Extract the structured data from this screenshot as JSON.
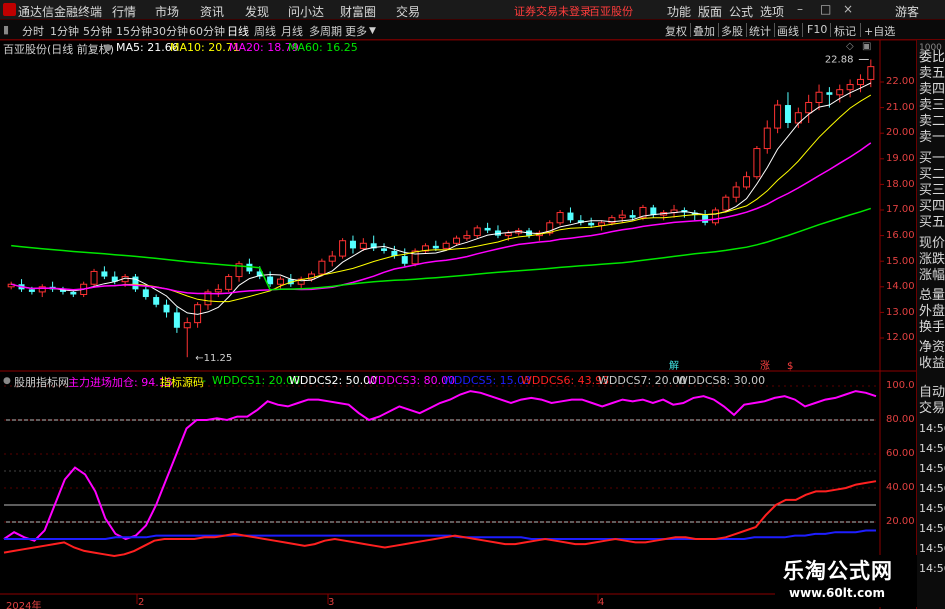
{
  "titlebar": {
    "app_name": "通达信金融终端",
    "menus": [
      "行情",
      "市场",
      "资讯",
      "发现",
      "问小达",
      "财富圈",
      "交易"
    ],
    "notice": "证券交易未登录",
    "stock_name": "百亚股份",
    "right_menus": [
      "功能",
      "版面",
      "公式",
      "选项"
    ],
    "guest": "游客"
  },
  "toolbar": {
    "periods": [
      "分时",
      "1分钟",
      "5分钟",
      "15分钟",
      "30分钟",
      "60分钟",
      "日线",
      "周线",
      "月线",
      "多周期",
      "更多"
    ],
    "active_period": "日线",
    "right_buttons": [
      "复权",
      "叠加",
      "多股",
      "统计",
      "画线",
      "F10",
      "标记",
      "+自选"
    ]
  },
  "main_chart": {
    "title": "百亚股份(日线 前复权)",
    "ma5": "MA5: 21.66",
    "ma10": "MA10: 20.71",
    "ma20": "MA20: 18.79",
    "ma60": "MA60: 16.25",
    "high_label": "22.88",
    "low_label": "11.25",
    "y_ticks": [
      "22.00",
      "21.00",
      "20.00",
      "19.00",
      "18.00",
      "17.00",
      "16.00",
      "15.00",
      "14.00",
      "13.00",
      "12.00"
    ],
    "markers": [
      "解",
      "涨",
      "$"
    ],
    "colors": {
      "up": "#ff3232",
      "down": "#54ffff",
      "ma5": "#ffffff",
      "ma10": "#ffff00",
      "ma20": "#ff00ff",
      "ma60": "#00e600"
    }
  },
  "indicator": {
    "name": "股朋指标网",
    "line1": "主力进场加仓: 94.15",
    "line2": "指标源码",
    "line3": "WDDCS1: 20.00",
    "line4": "WDDCS2: 50.00",
    "line5": "WDDCS3: 80.00",
    "line6": "WDDCS5: 15.03",
    "line7": "WDDCS6: 43.93",
    "line8": "WDDCS7: 20.00",
    "line9": "WDDCS8: 30.00",
    "y_ticks": [
      "100.0",
      "80.00",
      "60.00",
      "40.00",
      "20.00"
    ]
  },
  "x_axis": [
    "2024年",
    "2",
    "3",
    "4"
  ],
  "right_panel": {
    "items": [
      "委比",
      "卖五",
      "卖四",
      "卖三",
      "卖二",
      "卖一",
      "买一",
      "买二",
      "买三",
      "买四",
      "买五",
      "现价",
      "涨跌",
      "涨幅",
      "总量",
      "外盘",
      "换手",
      "净资",
      "收益"
    ],
    "items2": [
      "自动",
      "交易"
    ],
    "times": [
      "14:56",
      "14:56",
      "14:56",
      "14:56",
      "14:56",
      "14:56",
      "14:56",
      "14:56"
    ],
    "top_value": "1000"
  },
  "watermark": {
    "title": "乐淘公式网",
    "url": "www.60lt.com"
  },
  "chart_data": [
    {
      "type": "candlestick",
      "title": "百亚股份(日线 前复权)",
      "ylim": [
        11.0,
        23.0
      ],
      "candles": [
        [
          14.0,
          14.2,
          13.9,
          14.1
        ],
        [
          14.1,
          14.3,
          13.8,
          13.9
        ],
        [
          13.9,
          14.0,
          13.7,
          13.8
        ],
        [
          13.8,
          14.1,
          13.6,
          14.0
        ],
        [
          14.0,
          14.2,
          13.8,
          13.9
        ],
        [
          13.9,
          14.0,
          13.7,
          13.8
        ],
        [
          13.8,
          13.9,
          13.6,
          13.7
        ],
        [
          13.7,
          14.2,
          13.6,
          14.1
        ],
        [
          14.1,
          14.7,
          14.0,
          14.6
        ],
        [
          14.6,
          14.8,
          14.3,
          14.4
        ],
        [
          14.4,
          14.6,
          14.1,
          14.2
        ],
        [
          14.2,
          14.5,
          14.0,
          14.4
        ],
        [
          14.4,
          14.5,
          13.8,
          13.9
        ],
        [
          13.9,
          14.0,
          13.5,
          13.6
        ],
        [
          13.6,
          13.7,
          13.2,
          13.3
        ],
        [
          13.3,
          13.5,
          12.8,
          13.0
        ],
        [
          13.0,
          13.2,
          12.2,
          12.4
        ],
        [
          12.4,
          12.8,
          11.25,
          12.6
        ],
        [
          12.6,
          13.4,
          12.4,
          13.3
        ],
        [
          13.3,
          13.9,
          13.1,
          13.8
        ],
        [
          13.8,
          14.1,
          13.6,
          13.9
        ],
        [
          13.9,
          14.5,
          13.8,
          14.4
        ],
        [
          14.4,
          15.0,
          14.2,
          14.9
        ],
        [
          14.9,
          15.1,
          14.5,
          14.6
        ],
        [
          14.6,
          14.8,
          14.3,
          14.4
        ],
        [
          14.4,
          14.6,
          14.0,
          14.1
        ],
        [
          14.1,
          14.4,
          13.9,
          14.3
        ],
        [
          14.3,
          14.5,
          14.0,
          14.1
        ],
        [
          14.1,
          14.4,
          13.9,
          14.3
        ],
        [
          14.3,
          14.6,
          14.2,
          14.5
        ],
        [
          14.5,
          15.1,
          14.4,
          15.0
        ],
        [
          15.0,
          15.4,
          14.8,
          15.2
        ],
        [
          15.2,
          15.9,
          15.1,
          15.8
        ],
        [
          15.8,
          16.0,
          15.3,
          15.5
        ],
        [
          15.5,
          15.9,
          15.4,
          15.7
        ],
        [
          15.7,
          16.0,
          15.4,
          15.5
        ],
        [
          15.5,
          15.7,
          15.3,
          15.4
        ],
        [
          15.4,
          15.6,
          15.1,
          15.2
        ],
        [
          15.2,
          15.5,
          14.8,
          14.9
        ],
        [
          14.9,
          15.5,
          14.8,
          15.4
        ],
        [
          15.4,
          15.7,
          15.3,
          15.6
        ],
        [
          15.6,
          15.8,
          15.4,
          15.5
        ],
        [
          15.5,
          15.8,
          15.4,
          15.7
        ],
        [
          15.7,
          16.0,
          15.6,
          15.9
        ],
        [
          15.9,
          16.2,
          15.8,
          16.0
        ],
        [
          16.0,
          16.4,
          15.9,
          16.3
        ],
        [
          16.3,
          16.5,
          16.1,
          16.2
        ],
        [
          16.2,
          16.4,
          15.9,
          16.0
        ],
        [
          16.0,
          16.2,
          15.8,
          16.1
        ],
        [
          16.1,
          16.3,
          16.0,
          16.2
        ],
        [
          16.2,
          16.3,
          15.9,
          16.0
        ],
        [
          16.0,
          16.2,
          15.8,
          16.1
        ],
        [
          16.1,
          16.6,
          16.0,
          16.5
        ],
        [
          16.5,
          17.0,
          16.4,
          16.9
        ],
        [
          16.9,
          17.1,
          16.5,
          16.6
        ],
        [
          16.6,
          16.8,
          16.4,
          16.5
        ],
        [
          16.5,
          16.7,
          16.3,
          16.4
        ],
        [
          16.4,
          16.6,
          16.2,
          16.5
        ],
        [
          16.5,
          16.8,
          16.4,
          16.7
        ],
        [
          16.7,
          17.0,
          16.5,
          16.8
        ],
        [
          16.8,
          17.0,
          16.6,
          16.7
        ],
        [
          16.7,
          17.2,
          16.6,
          17.1
        ],
        [
          17.1,
          17.2,
          16.7,
          16.8
        ],
        [
          16.8,
          17.0,
          16.6,
          16.9
        ],
        [
          16.9,
          17.2,
          16.7,
          17.0
        ],
        [
          17.0,
          17.1,
          16.7,
          16.9
        ],
        [
          16.9,
          17.0,
          16.6,
          16.8
        ],
        [
          16.8,
          17.0,
          16.4,
          16.5
        ],
        [
          16.5,
          17.1,
          16.4,
          17.0
        ],
        [
          17.0,
          17.6,
          16.9,
          17.5
        ],
        [
          17.5,
          18.1,
          17.3,
          17.9
        ],
        [
          17.9,
          18.5,
          17.8,
          18.3
        ],
        [
          18.3,
          19.5,
          18.2,
          19.4
        ],
        [
          19.4,
          20.5,
          19.2,
          20.2
        ],
        [
          20.2,
          21.3,
          20.0,
          21.1
        ],
        [
          21.1,
          21.6,
          20.2,
          20.4
        ],
        [
          20.4,
          21.0,
          20.2,
          20.8
        ],
        [
          20.8,
          21.5,
          20.4,
          21.2
        ],
        [
          21.2,
          21.9,
          20.9,
          21.6
        ],
        [
          21.6,
          21.8,
          21.0,
          21.5
        ],
        [
          21.5,
          21.9,
          21.2,
          21.7
        ],
        [
          21.7,
          22.1,
          21.4,
          21.9
        ],
        [
          21.9,
          22.3,
          21.6,
          22.1
        ],
        [
          22.1,
          22.88,
          21.8,
          22.6
        ]
      ],
      "ma5_last": 21.66,
      "ma10_last": 20.71,
      "ma20_last": 18.79,
      "ma60_last": 16.25
    },
    {
      "type": "line",
      "title": "股朋指标网",
      "ylim": [
        0,
        100
      ],
      "series": [
        {
          "name": "主力进场加仓",
          "color": "#ff00ff",
          "values": [
            10,
            14,
            11,
            9,
            15,
            30,
            45,
            52,
            48,
            38,
            22,
            13,
            10,
            12,
            18,
            30,
            45,
            60,
            75,
            80,
            80,
            81,
            80,
            82,
            82,
            86,
            91,
            89,
            88,
            90,
            92,
            92,
            91,
            90,
            89,
            84,
            80,
            82,
            85,
            88,
            86,
            84,
            87,
            90,
            92,
            95,
            97,
            96,
            94,
            92,
            90,
            92,
            93,
            92,
            90,
            91,
            92,
            92,
            90,
            88,
            90,
            92,
            91,
            92,
            90,
            92,
            89,
            90,
            93,
            94,
            92,
            88,
            83,
            89,
            90,
            91,
            93,
            94,
            92,
            88,
            90,
            92,
            93,
            95,
            97,
            96,
            94
          ]
        },
        {
          "name": "WDDCS5",
          "color": "#1e1eff",
          "values": [
            10,
            10,
            10,
            10,
            10,
            10,
            10,
            10,
            10,
            10,
            10,
            11,
            11,
            11,
            11,
            12,
            12,
            12,
            12,
            12,
            12,
            12,
            12,
            12,
            12,
            12,
            12,
            12,
            12,
            12,
            12,
            12,
            12,
            12,
            12,
            12,
            12,
            12,
            12,
            12,
            12,
            12,
            12,
            12,
            12,
            11,
            11,
            11,
            11,
            11,
            11,
            11,
            10,
            10,
            10,
            10,
            10,
            10,
            10,
            10,
            10,
            10,
            10,
            10,
            10,
            10,
            10,
            10,
            10,
            10,
            10,
            10,
            10,
            10,
            11,
            11,
            11,
            11,
            12,
            12,
            13,
            13,
            14,
            14,
            14,
            15,
            15
          ]
        },
        {
          "name": "WDDCS6",
          "color": "#ff2020",
          "values": [
            2,
            3,
            4,
            5,
            6,
            7,
            8,
            5,
            3,
            2,
            1,
            0,
            1,
            3,
            6,
            9,
            10,
            10,
            10,
            10,
            11,
            11,
            12,
            13,
            12,
            11,
            10,
            9,
            8,
            7,
            6,
            7,
            9,
            10,
            9,
            8,
            7,
            6,
            5,
            6,
            7,
            8,
            9,
            10,
            11,
            12,
            11,
            10,
            9,
            8,
            7,
            7,
            8,
            9,
            10,
            9,
            8,
            7,
            7,
            8,
            9,
            10,
            9,
            8,
            8,
            9,
            10,
            11,
            11,
            10,
            10,
            10,
            11,
            13,
            15,
            17,
            24,
            30,
            33,
            33,
            36,
            38,
            38,
            39,
            40,
            42,
            43,
            44
          ]
        }
      ],
      "reference_lines": [
        20,
        30,
        50,
        80
      ]
    }
  ]
}
